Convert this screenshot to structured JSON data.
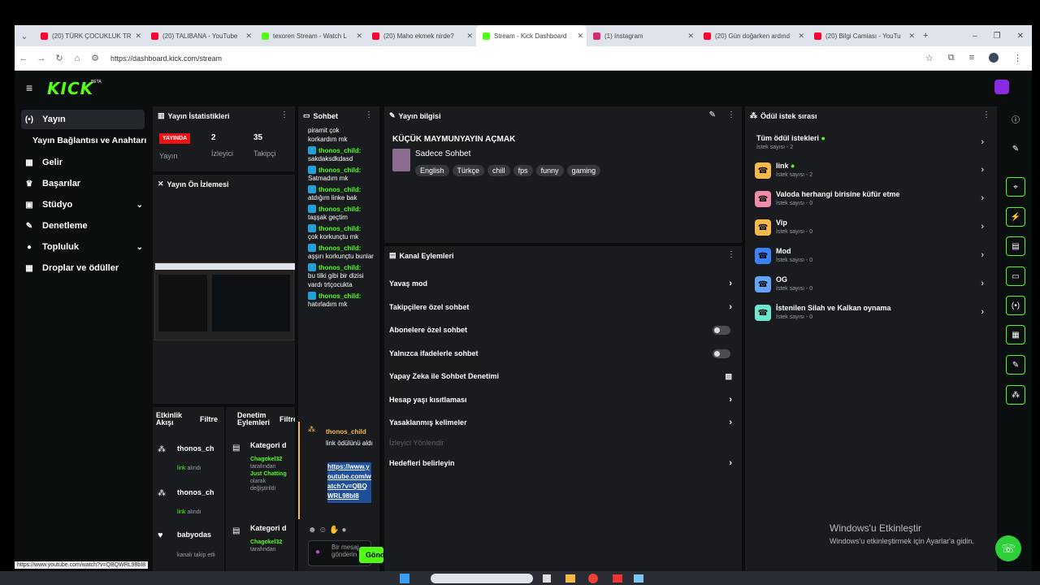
{
  "browser": {
    "tabs": [
      {
        "label": "(20) TÜRK ÇOCUKLUK TR",
        "color": "#ff0033"
      },
      {
        "label": "(20) TALIBANA - YouTube",
        "color": "#ff0033"
      },
      {
        "label": "texoren Stream - Watch L",
        "color": "#53fc18"
      },
      {
        "label": "(20) Maho ekmek nirde?",
        "color": "#ff0033"
      },
      {
        "label": "Stream - Kick Dashboard",
        "color": "#53fc18"
      },
      {
        "label": "(1) Instagram",
        "color": "#d62976"
      },
      {
        "label": "(20) Gün doğarken ardınd",
        "color": "#ff0033"
      },
      {
        "label": "(20) Bilgi Camiası - YouTu",
        "color": "#ff0033"
      }
    ],
    "url": "https://dashboard.kick.com/stream",
    "status_url": "https://www.youtube.com/watch?v=QBQWRL98bI8"
  },
  "header": {
    "logo": "KICK",
    "beta": "BETA"
  },
  "sidebar": {
    "items": [
      {
        "label": "Yayın",
        "icon": "(•)"
      },
      {
        "label": "Yayın Bağlantısı ve Anahtarı",
        "icon": ""
      },
      {
        "label": "Gelir",
        "icon": "▦"
      },
      {
        "label": "Başarılar",
        "icon": "🏆"
      },
      {
        "label": "Stüdyo",
        "icon": "▣"
      },
      {
        "label": "Denetleme",
        "icon": "🔧"
      },
      {
        "label": "Topluluk",
        "icon": "●"
      },
      {
        "label": "Droplar ve ödüller",
        "icon": "▦"
      }
    ]
  },
  "stats": {
    "title": "Yayın İstatistikleri",
    "live_badge": "YAYINDA",
    "live_label": "Yayın",
    "viewers": "2",
    "viewers_label": "İzleyici",
    "followers": "35",
    "followers_label": "Takipçi"
  },
  "preview": {
    "title": "Yayın Ön İzlemesi"
  },
  "activity": {
    "title": "Etkinlik Akışı",
    "filter": "Filtre",
    "items": [
      {
        "user": "thonos_ch",
        "desc_a": "link",
        "desc_b": " alındı"
      },
      {
        "user": "thonos_ch",
        "desc_a": "link",
        "desc_b": " alındı"
      },
      {
        "user": "babyodas",
        "desc_a": "",
        "desc_b": "kanalı takip etti"
      }
    ]
  },
  "moderation": {
    "title": "Denetim Eylemleri",
    "filter": "Filtre",
    "items": [
      {
        "title": "Kategori d",
        "user": "Chagokel32",
        "by": "tarafından",
        "target": "Just Chatting",
        "olarak": "olarak",
        "changed": "değiştirildi"
      },
      {
        "title": "Kategori d",
        "user": "Chagokel32",
        "by": "tarafından",
        "target": "",
        "olarak": "",
        "changed": ""
      }
    ]
  },
  "chat": {
    "title": "Sohbet",
    "top_lines": [
      "piramit çok",
      "korkardım mk"
    ],
    "messages": [
      {
        "user": "thonos_child:",
        "text": "sakdaksdkdasd"
      },
      {
        "user": "thonos_child:",
        "text": "Satmadım mk"
      },
      {
        "user": "thonos_child:",
        "text": "atdığım linke bak"
      },
      {
        "user": "thonos_child:",
        "text": "taşşak geçtim"
      },
      {
        "user": "thonos_child:",
        "text": "çok korkunçtu mk"
      },
      {
        "user": "thonos_child:",
        "text": "aşşırı korkunçtu bunlar"
      },
      {
        "user": "thonos_child:",
        "text": "bu tilki gibi bir dizisi vardı trtçocukta"
      },
      {
        "user": "thonos_child:",
        "text": "hatırladım mk"
      }
    ],
    "reward": {
      "user": "thonos_child",
      "text": "link ödülünü aldı",
      "link": "https://www.youtube.com/watch?v=QBQWRL98bI8"
    },
    "input_placeholder": "Bir mesaj gönderin",
    "send": "Gönder"
  },
  "stream_info": {
    "title": "Yayın bilgisi",
    "stream_title": "KÜÇÜK MAYMUNYAYIN AÇMAK",
    "category": "Sadece Sohbet",
    "tags": [
      "English",
      "Türkçe",
      "chill",
      "fps",
      "funny",
      "gaming"
    ]
  },
  "channel_actions": {
    "title": "Kanal Eylemleri",
    "rows": [
      {
        "label": "Yavaş mod",
        "kind": "arrow"
      },
      {
        "label": "Takipçilere özel sohbet",
        "kind": "arrow"
      },
      {
        "label": "Abonelere özel sohbet",
        "kind": "toggle"
      },
      {
        "label": "Yalnızca ifadelerle sohbet",
        "kind": "toggle"
      },
      {
        "label": "Yapay Zeka ile Sohbet Denetimi",
        "kind": "chart"
      },
      {
        "label": "Hesap yaşı kısıtlaması",
        "kind": "arrow"
      },
      {
        "label": "Yasaklanmış kelimeler",
        "kind": "arrow"
      },
      {
        "label": "İzleyici Yönlendir",
        "kind": "disabled"
      },
      {
        "label": "Hedefleri belirleyin",
        "kind": "arrow"
      }
    ]
  },
  "rewards": {
    "title": "Ödül istek sırası",
    "all_title": "Tüm ödül istekleri",
    "all_count": "İstek sayısı - 2",
    "items": [
      {
        "name": "link",
        "count": "İstek sayısı - 2",
        "color": "#f5b84a",
        "dot": true
      },
      {
        "name": "Valoda herhangi birisine küfür etme",
        "count": "İstek sayısı - 0",
        "color": "#f28ba8",
        "dot": false
      },
      {
        "name": "Vip",
        "count": "İstek sayısı - 0",
        "color": "#f5b84a",
        "dot": false
      },
      {
        "name": "Mod",
        "count": "İstek sayısı - 0",
        "color": "#3b82f6",
        "dot": false
      },
      {
        "name": "OG",
        "count": "İstek sayısı - 0",
        "color": "#60a5fa",
        "dot": false
      },
      {
        "name": "İstenilen Silah ve Kalkan oynama",
        "count": "İstek sayısı - 0",
        "color": "#6ee7d0",
        "dot": false
      }
    ]
  },
  "windows": {
    "activate_title": "Windows'u Etkinleştir",
    "activate_sub": "Windows'u etkinleştirmek için Ayarlar'a gidin."
  }
}
